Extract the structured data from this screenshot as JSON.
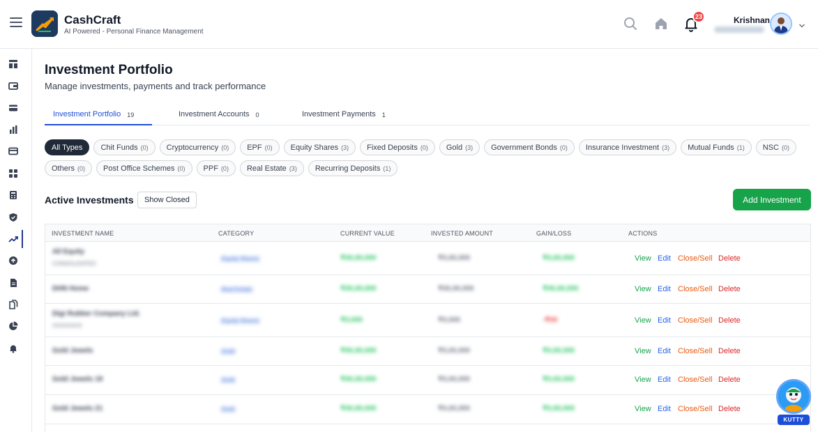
{
  "header": {
    "app_title": "CashCraft",
    "app_subtitle": "AI Powered - Personal Finance Management",
    "notification_count": "23",
    "user_name": "Krishnan"
  },
  "sidebar": {
    "items": [
      {
        "icon": "dashboard-icon"
      },
      {
        "icon": "wallet-icon"
      },
      {
        "icon": "credit-card-icon"
      },
      {
        "icon": "bar-chart-icon"
      },
      {
        "icon": "card-icon"
      },
      {
        "icon": "grid-icon"
      },
      {
        "icon": "calculator-icon"
      },
      {
        "icon": "shield-icon"
      },
      {
        "icon": "trending-up-icon",
        "active": true
      },
      {
        "icon": "upload-icon"
      },
      {
        "icon": "document-icon"
      },
      {
        "icon": "documents-icon"
      },
      {
        "icon": "pie-chart-icon"
      },
      {
        "icon": "bell-icon"
      }
    ]
  },
  "page": {
    "title": "Investment Portfolio",
    "subtitle": "Manage investments, payments and track performance"
  },
  "tabs": [
    {
      "label": "Investment Portfolio",
      "count": "19",
      "active": true
    },
    {
      "label": "Investment Accounts",
      "count": "0"
    },
    {
      "label": "Investment Payments",
      "count": "1"
    }
  ],
  "filters": {
    "row1": [
      {
        "label": "All Types",
        "count": "",
        "active": true
      },
      {
        "label": "Chit Funds",
        "count": "(0)"
      },
      {
        "label": "Cryptocurrency",
        "count": "(0)"
      },
      {
        "label": "EPF",
        "count": "(0)"
      },
      {
        "label": "Equity Shares",
        "count": "(3)"
      },
      {
        "label": "Fixed Deposits",
        "count": "(0)"
      },
      {
        "label": "Gold",
        "count": "(3)"
      },
      {
        "label": "Government Bonds",
        "count": "(0)"
      },
      {
        "label": "Insurance Investment",
        "count": "(3)"
      },
      {
        "label": "Mutual Funds",
        "count": "(1)"
      },
      {
        "label": "NSC",
        "count": "(0)"
      }
    ],
    "row2": [
      {
        "label": "Others",
        "count": "(0)"
      },
      {
        "label": "Post Office Schemes",
        "count": "(0)"
      },
      {
        "label": "PPF",
        "count": "(0)"
      },
      {
        "label": "Real Estate",
        "count": "(3)"
      },
      {
        "label": "Recurring Deposits",
        "count": "(1)"
      }
    ]
  },
  "section": {
    "title": "Active Investments",
    "show_closed_label": "Show Closed",
    "add_label": "Add Investment"
  },
  "table": {
    "columns": [
      "Investment Name",
      "Category",
      "Current Value",
      "Invested Amount",
      "Gain/Loss",
      "Actions"
    ],
    "rows": [
      {
        "name": "All Equity",
        "sub": "CONSOLIDATED",
        "category": "Equity Shares",
        "current": "₹00,00,000",
        "invested": "₹0,00,000",
        "gain": "₹0,00,000",
        "gain_positive": true
      },
      {
        "name": "DHN Home",
        "sub": "",
        "category": "Real Estate",
        "current": "₹00,00,000",
        "invested": "₹00,00,000",
        "gain": "₹00,00,000",
        "gain_positive": true
      },
      {
        "name": "Digi Rubber Company Ltd.",
        "sub": "XXXXXXXX",
        "category": "Equity Shares",
        "current": "₹0,000",
        "invested": "₹0,000",
        "gain": "-₹00",
        "gain_positive": false
      },
      {
        "name": "Gold Jewels",
        "sub": "",
        "category": "Gold",
        "current": "₹00,00,000",
        "invested": "₹0,00,000",
        "gain": "₹0,00,000",
        "gain_positive": true
      },
      {
        "name": "Gold Jewels 18",
        "sub": "",
        "category": "Gold",
        "current": "₹00,00,000",
        "invested": "₹0,00,000",
        "gain": "₹0,00,000",
        "gain_positive": true
      },
      {
        "name": "Gold Jewels 21",
        "sub": "",
        "category": "Gold",
        "current": "₹00,00,000",
        "invested": "₹0,00,000",
        "gain": "₹0,00,000",
        "gain_positive": true
      }
    ],
    "actions": {
      "view": "View",
      "edit": "Edit",
      "close": "Close/Sell",
      "delete": "Delete"
    }
  },
  "assistant": {
    "label": "KUTTY"
  },
  "colors": {
    "accent": "#1d4ed8",
    "primary_button": "#16a34a",
    "positive": "#16a34a",
    "negative": "#dc2626",
    "warning": "#ea580c"
  }
}
